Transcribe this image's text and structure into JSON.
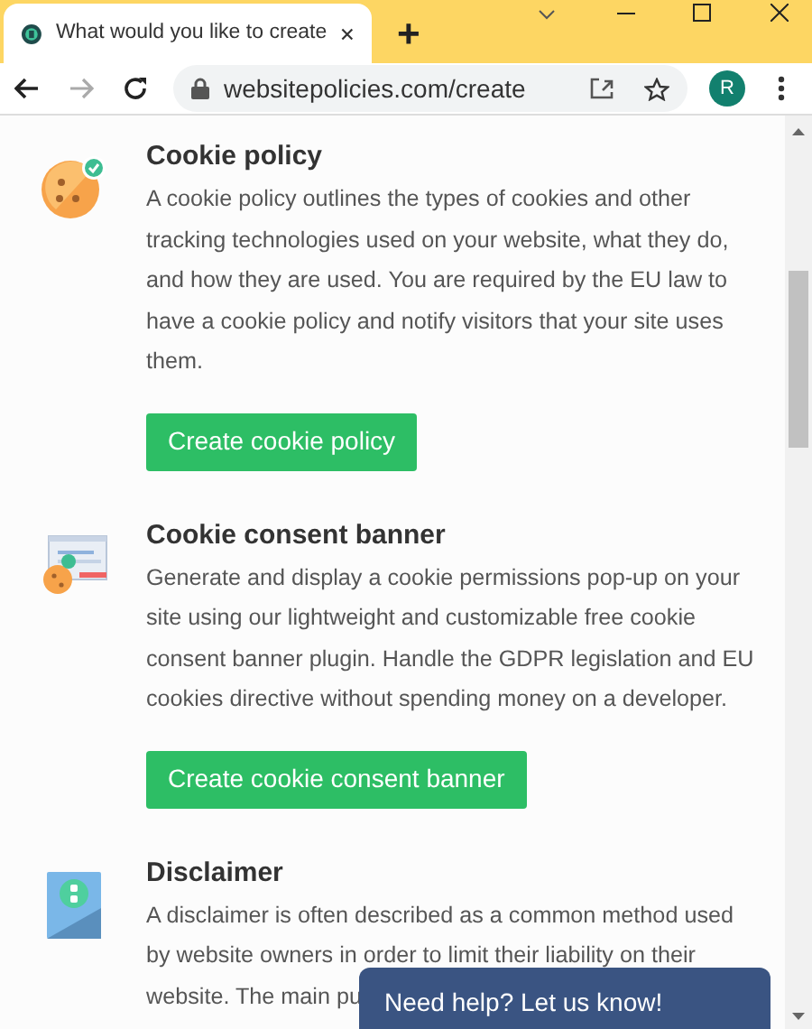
{
  "browser": {
    "tab_title": "What would you like to create",
    "new_tab": "+",
    "url": "websitepolicies.com/create",
    "profile_initial": "R"
  },
  "sections": [
    {
      "kind": "cookie",
      "title": "Cookie policy",
      "lines": [
        "A cookie policy outlines the types of cookies and other",
        "tracking technologies used on your website, what they do,",
        "and how they are used. You are required by the EU law to",
        "have a cookie policy and notify visitors that your site uses",
        "them."
      ],
      "button": "Create cookie policy"
    },
    {
      "kind": "banner",
      "title": "Cookie consent banner",
      "lines": [
        "Generate and display a cookie permissions pop-up on your",
        "site using our lightweight and customizable free cookie",
        "consent banner plugin. Handle the GDPR legislation and EU",
        "cookies directive without spending money on a developer."
      ],
      "button": "Create cookie consent banner"
    },
    {
      "kind": "disclaimer",
      "title": "Disclaimer",
      "lines": [
        "A disclaimer is often described as a common method used",
        "by website owners in order to limit their liability on their",
        "website. The main pu"
      ]
    }
  ],
  "help_widget": "Need help? Let us know!"
}
